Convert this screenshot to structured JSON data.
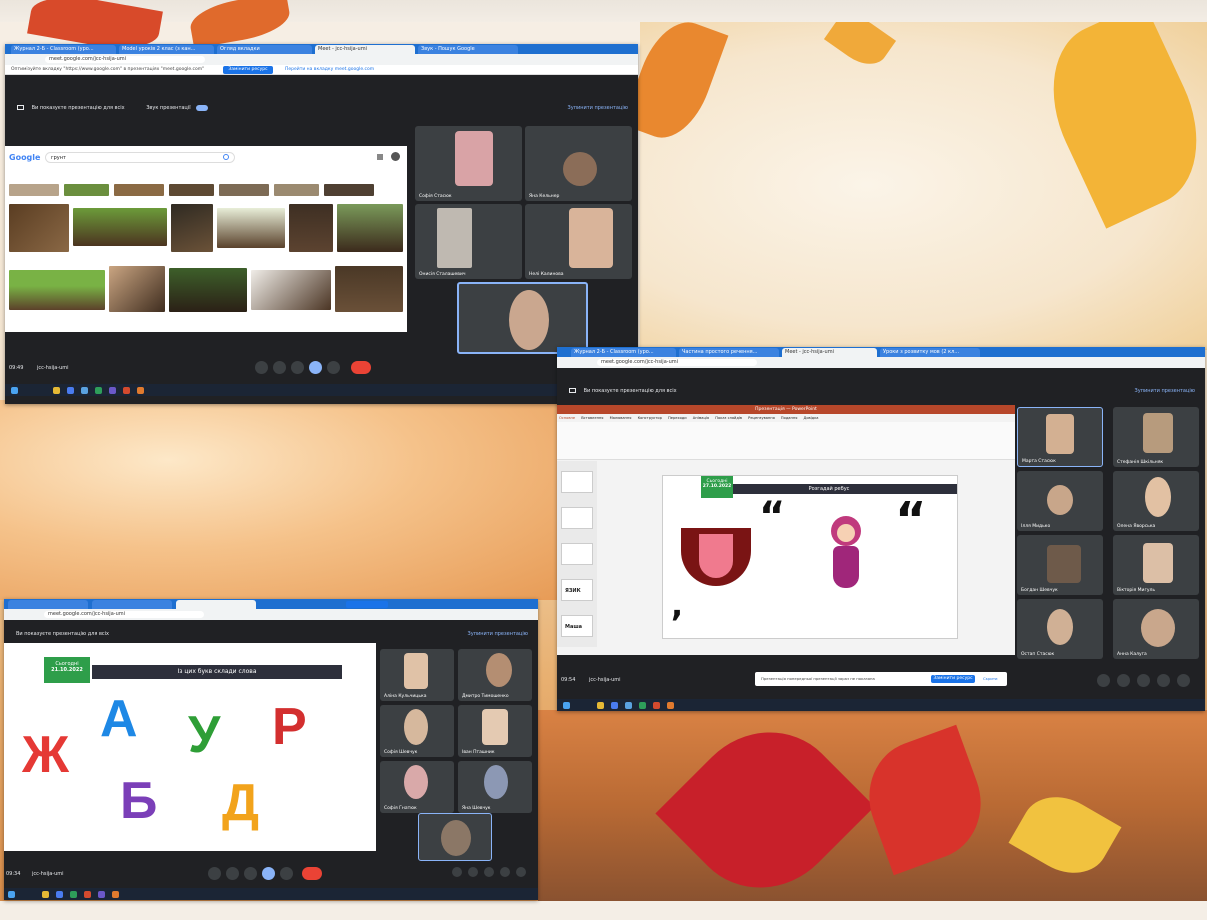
{
  "background": {
    "colors": [
      "#f4e6d4",
      "#e8a25c",
      "#c44a2a",
      "#f2c24a"
    ]
  },
  "shot1": {
    "tabs": [
      "Журнал 2-Б - Classroom (уро...",
      "Model уроків 2 клас (з кан...",
      "Огляд вкладки",
      "Meet - jcc-hsija-umi",
      "Звук - Пошук Google"
    ],
    "url": "meet.google.com/jcc-hsija-umi",
    "infobar": "Оптимізуйте вкладку \"https://www.google.com\" в презентаціях \"meet.google.com\"",
    "infobar_btn": "Замінити ресурс",
    "infobar_link": "Перейти на вкладку meet.google.com",
    "pres_text": "Ви показуєте презентацію для всіх",
    "pres_sound": "Звук презентації",
    "pres_stop": "Зупинити презентацію",
    "search_query": "грунт",
    "google_logo": "Google",
    "participants": [
      "Софія Стасюк",
      "Яна Кельнер",
      "Онисія Сталашевич",
      "Нелі Калинова"
    ],
    "meeting_time": "09:49",
    "meeting_code": "jcc-hsija-umi"
  },
  "shot2": {
    "tabs": [
      "Журнал 2-Б - Classroom (уро...",
      "Частина простого речення...",
      "Meet - jcc-hsija-umi",
      "Уроки з розвитку мов (2 кл..."
    ],
    "url": "meet.google.com/jcc-hsija-umi",
    "pres_text": "Ви показуєте презентацію для всіх",
    "pres_stop": "Зупинити презентацію",
    "ppt_title": "Презентація — PowerPoint",
    "ppt_menu": [
      "Основне",
      "Вставлення",
      "Малювання",
      "Конструктор",
      "Переходи",
      "Анімація",
      "Показ слайдів",
      "Рецензування",
      "Подання",
      "Довідка"
    ],
    "slide_badge_line1": "Сьогодні",
    "slide_badge_line2": "27.10.2022",
    "slide_header": "Розгадай ребус",
    "thumb_labels": [
      "ЯЗИК",
      "Маша"
    ],
    "participants": [
      "Марта Стасюк",
      "Стефанія Шкільняк",
      "Ілля Мидько",
      "Олена Яворська",
      "Богдан Шевчук",
      "Вікторія Мигуль",
      "Остап Стасюк",
      "Анна Калуга"
    ],
    "meeting_time": "09:54",
    "meeting_code": "jcc-hsija-umi",
    "notice": "Презентація попередньої презентації зараз не показана",
    "notice_btn": "Замінити ресурс",
    "notice_link": "Скрити"
  },
  "shot3": {
    "url": "meet.google.com/jcc-hsija-umi",
    "pres_text": "Ви показуєте презентацію для всіх",
    "pres_stop": "Зупинити презентацію",
    "slide_badge_line1": "Сьогодні",
    "slide_badge_line2": "21.10.2022",
    "slide_header": "Із цих букв склади слова",
    "letters": [
      {
        "char": "Ж",
        "color": "#e53935"
      },
      {
        "char": "А",
        "color": "#1e88e5"
      },
      {
        "char": "У",
        "color": "#2e9e36"
      },
      {
        "char": "Р",
        "color": "#d32f2f"
      },
      {
        "char": "Б",
        "color": "#7b3fb8"
      },
      {
        "char": "Д",
        "color": "#f2a31b"
      }
    ],
    "participants": [
      "Аліна Кульчицька",
      "Дмитро Тимошенко",
      "Софія Шевчук",
      "Іван Пташник",
      "Софія Гнатюк",
      "Яна Шевчук"
    ],
    "meeting_time": "09:34",
    "meeting_code": "jcc-hsija-umi"
  }
}
